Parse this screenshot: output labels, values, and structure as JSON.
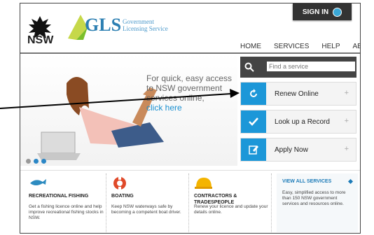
{
  "header": {
    "signin_label": "SIGN IN",
    "nsw_text": "NSW",
    "gls_text": "GLS",
    "gls_sub_1": "Government",
    "gls_sub_2": "Licensing Service"
  },
  "nav": [
    "HOME",
    "SERVICES",
    "HELP",
    "ABOUT"
  ],
  "hero": {
    "text": "For quick, easy access to NSW government services online,",
    "link": "click here"
  },
  "search": {
    "placeholder": "Find a service"
  },
  "actions": [
    {
      "label": "Renew Online",
      "icon": "refresh-icon"
    },
    {
      "label": "Look up a Record",
      "icon": "checkmark-icon"
    },
    {
      "label": "Apply Now",
      "icon": "edit-icon"
    }
  ],
  "plus_symbol": "+",
  "categories": [
    {
      "title": "RECREATIONAL FISHING",
      "desc": "Get a fishing licence online and help improve recreational fishing stocks in NSW.",
      "icon": "fish-icon"
    },
    {
      "title": "BOATING",
      "desc": "Keep NSW waterways safe by becoming a competent boat driver.",
      "icon": "lifebuoy-icon"
    },
    {
      "title": "CONTRACTORS & TRADESPEOPLE",
      "desc": "Renew your licence and update your details online.",
      "icon": "hardhat-icon"
    }
  ],
  "view_all": {
    "title": "VIEW ALL SERVICES",
    "desc": "Easy, simplified access to more than 150 NSW government services and resources online."
  },
  "colors": {
    "accent": "#1c97d8",
    "dark": "#444444"
  }
}
